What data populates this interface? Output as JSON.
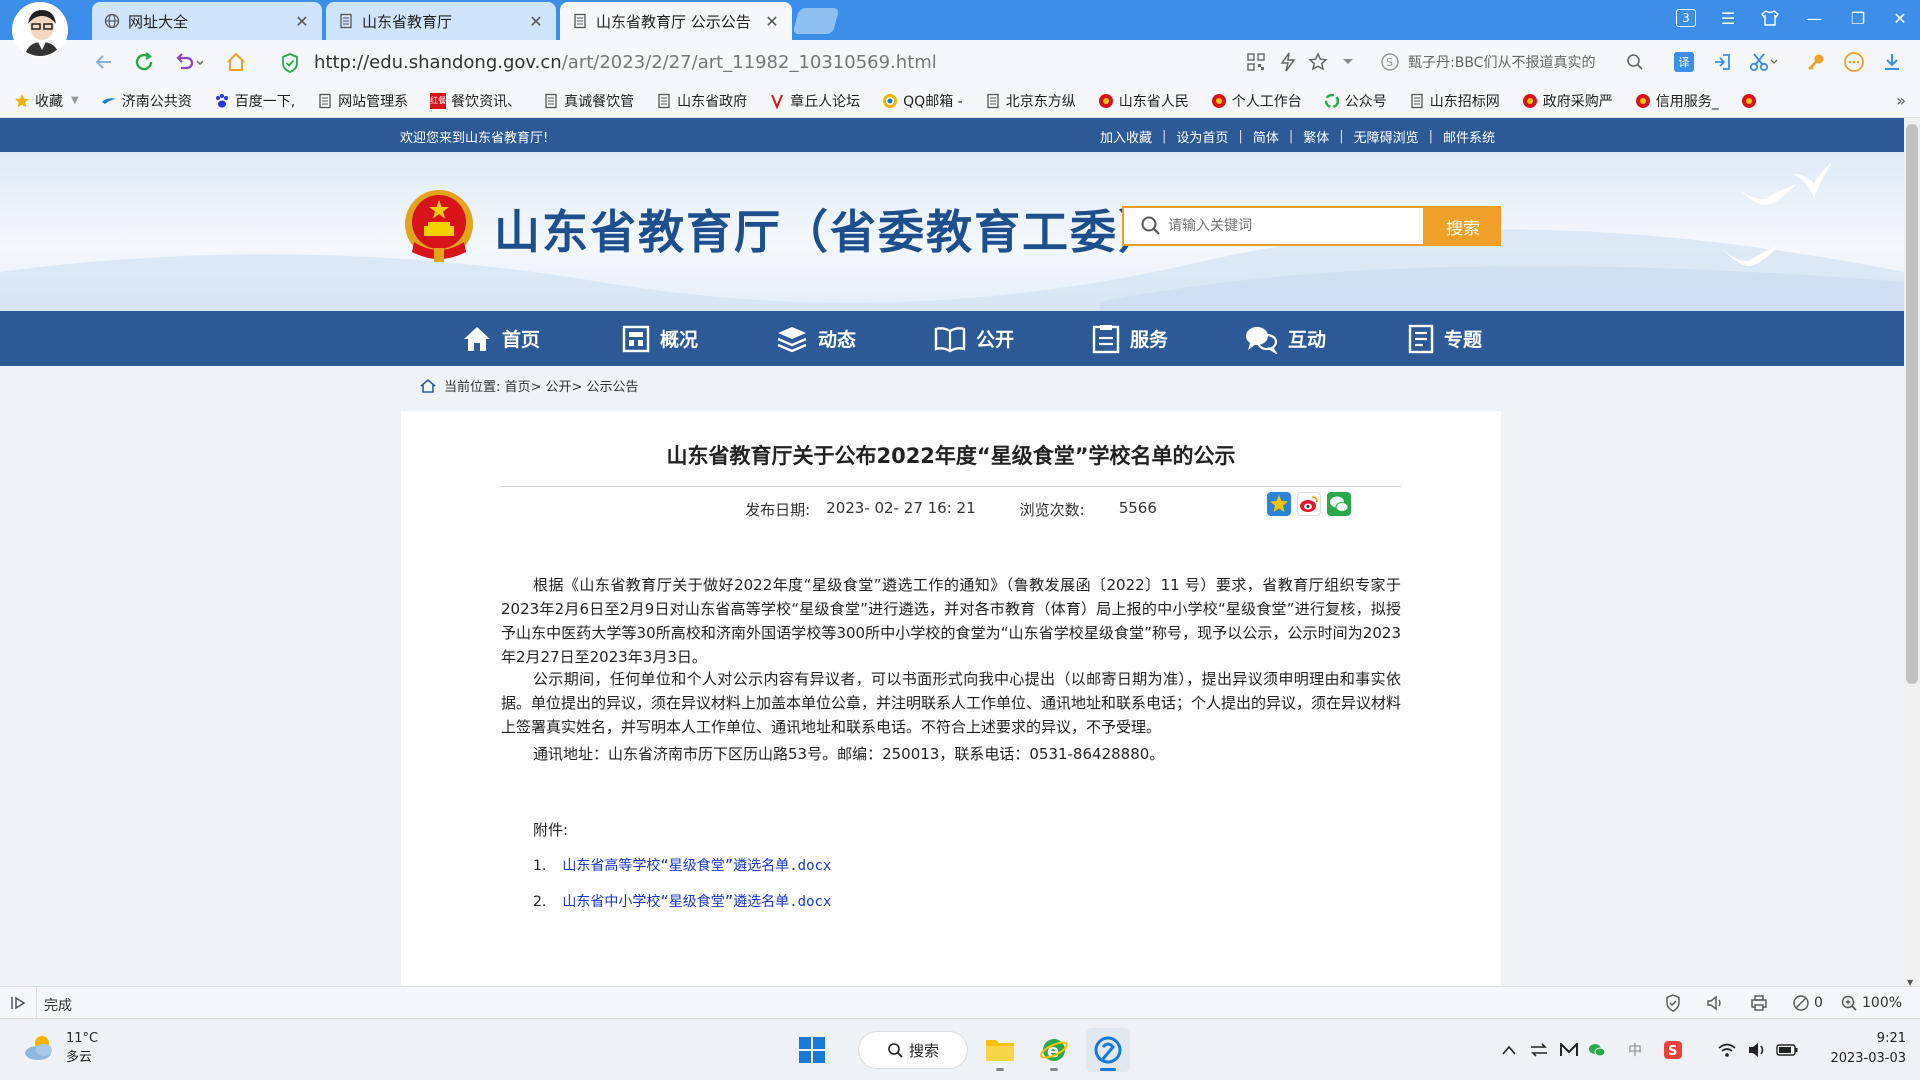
{
  "browser": {
    "tabs": [
      {
        "label": "网址大全",
        "active": false
      },
      {
        "label": "山东省教育厅",
        "active": false
      },
      {
        "label": "山东省教育厅 公示公告",
        "active": true
      }
    ],
    "tab_count_badge": "3",
    "url_host": "http://edu.shandong.gov.cn",
    "url_path": "/art/2023/2/27/art_11982_10310569.html",
    "search_suggestion": "甄子丹:BBC们从不报道真实的",
    "bookmarks": [
      "收藏",
      "济南公共资",
      "百度一下,",
      "网站管理系",
      "餐饮资讯、",
      "真诚餐饮管",
      "山东省政府",
      "章丘人论坛",
      "QQ邮箱 -",
      "北京东方纵",
      "山东省人民",
      "个人工作台",
      "公众号",
      "山东招标网",
      "政府采购严",
      "信用服务_"
    ],
    "bookmark_brand_tag": "红餐",
    "status": "完成",
    "status_count": "0",
    "zoom": "100%"
  },
  "site": {
    "welcome": "欢迎您来到山东省教育厅!",
    "top_links": [
      "加入收藏",
      "设为首页",
      "简体",
      "繁体",
      "无障碍浏览",
      "邮件系统"
    ],
    "title": "山东省教育厅（省委教育工委）",
    "search_placeholder": "请输入关键词",
    "search_button": "搜索",
    "nav": [
      "首页",
      "概况",
      "动态",
      "公开",
      "服务",
      "互动",
      "专题"
    ],
    "breadcrumb": "当前位置: 首页> 公开> 公示公告",
    "colors": {
      "primary": "#2d5a96",
      "accent": "#f0a028"
    }
  },
  "article": {
    "title": "山东省教育厅关于公布2022年度“星级食堂”学校名单的公示",
    "date_label": "发布日期:",
    "date": "2023- 02- 27 16: 21",
    "views_label": "浏览次数:",
    "views": "5566",
    "paragraphs": [
      "根据《山东省教育厅关于做好2022年度“星级食堂”遴选工作的通知》（鲁教发展函〔2022〕11 号）要求，省教育厅组织专家于2023年2月6日至2月9日对山东省高等学校“星级食堂”进行遴选，并对各市教育（体育）局上报的中小学校“星级食堂”进行复核，拟授予山东中医药大学等30所高校和济南外国语学校等300所中小学校的食堂为“山东省学校星级食堂”称号，现予以公示，公示时间为2023年2月27日至2023年3月3日。",
      "公示期间，任何单位和个人对公示内容有异议者，可以书面形式向我中心提出（以邮寄日期为准），提出异议须申明理由和事实依据。单位提出的异议，须在异议材料上加盖本单位公章，并注明联系人工作单位、通讯地址和联系电话；个人提出的异议，须在异议材料上签署真实姓名，并写明本人工作单位、通讯地址和联系电话。不符合上述要求的异议，不予受理。",
      "通讯地址：山东省济南市历下区历山路53号。邮编：250013，联系电话：0531-86428880。"
    ],
    "attachment_label": "附件:",
    "attachments": [
      {
        "num": "1.",
        "name": "山东省高等学校“星级食堂”遴选名单.docx"
      },
      {
        "num": "2.",
        "name": "山东省中小学校“星级食堂”遴选名单.docx"
      }
    ]
  },
  "taskbar": {
    "weather_temp": "11°C",
    "weather_desc": "多云",
    "search_label": "搜索",
    "ime": "中",
    "time": "9:21",
    "date": "2023-03-03"
  }
}
